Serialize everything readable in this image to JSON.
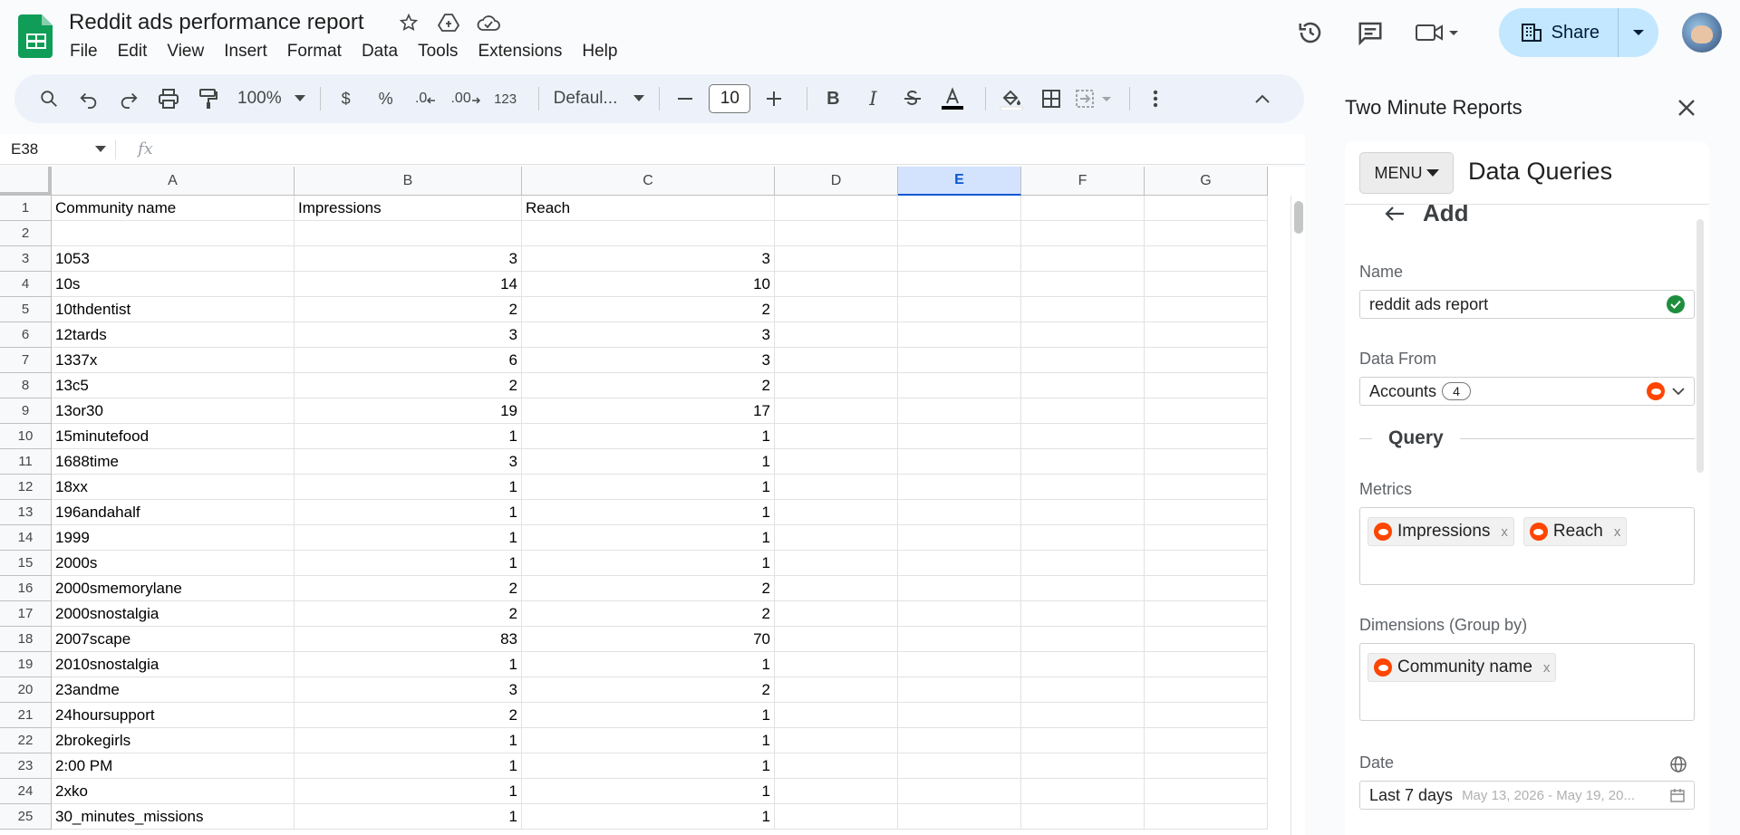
{
  "doc": {
    "title": "Reddit ads performance report",
    "menus": [
      "File",
      "Edit",
      "View",
      "Insert",
      "Format",
      "Data",
      "Tools",
      "Extensions",
      "Help"
    ],
    "share_label": "Share"
  },
  "toolbar": {
    "zoom": "100%",
    "currency": "$",
    "percent": "%",
    "dec_decrease": ".0",
    "dec_increase": ".00",
    "more_formats": "123",
    "font": "Defaul...",
    "font_size": "10",
    "bold": "B",
    "italic": "I"
  },
  "formula": {
    "cell_ref": "E38",
    "fx": "fx"
  },
  "sheet": {
    "columns": [
      "A",
      "B",
      "C",
      "D",
      "E",
      "F",
      "G"
    ],
    "selected_column": "E",
    "header_row": [
      "Community name",
      "Impressions",
      "Reach"
    ],
    "rows": [
      [
        "1053",
        "3",
        "3"
      ],
      [
        "10s",
        "14",
        "10"
      ],
      [
        "10thdentist",
        "2",
        "2"
      ],
      [
        "12tards",
        "3",
        "3"
      ],
      [
        "1337x",
        "6",
        "3"
      ],
      [
        "13c5",
        "2",
        "2"
      ],
      [
        "13or30",
        "19",
        "17"
      ],
      [
        "15minutefood",
        "1",
        "1"
      ],
      [
        "1688time",
        "3",
        "1"
      ],
      [
        "18xx",
        "1",
        "1"
      ],
      [
        "196andahalf",
        "1",
        "1"
      ],
      [
        "1999",
        "1",
        "1"
      ],
      [
        "2000s",
        "1",
        "1"
      ],
      [
        "2000smemorylane",
        "2",
        "2"
      ],
      [
        "2000snostalgia",
        "2",
        "2"
      ],
      [
        "2007scape",
        "83",
        "70"
      ],
      [
        "2010snostalgia",
        "1",
        "1"
      ],
      [
        "23andme",
        "3",
        "2"
      ],
      [
        "24hoursupport",
        "2",
        "1"
      ],
      [
        "2brokegirls",
        "1",
        "1"
      ],
      [
        "2:00 PM",
        "1",
        "1"
      ],
      [
        "2xko",
        "1",
        "1"
      ],
      [
        "30_minutes_missions",
        "1",
        "1"
      ]
    ]
  },
  "panel": {
    "title": "Two Minute Reports",
    "menu_label": "MENU",
    "card_title": "Data Queries",
    "add_label": "Add",
    "name_label": "Name",
    "name_value": "reddit ads report",
    "data_from_label": "Data From",
    "data_from_value": "Accounts",
    "accounts_count": "4",
    "query_label": "Query",
    "metrics_label": "Metrics",
    "metrics": [
      "Impressions",
      "Reach"
    ],
    "dimensions_label": "Dimensions (Group by)",
    "dimensions": [
      "Community name"
    ],
    "date_label": "Date",
    "date_value": "Last 7 days",
    "date_range": "May 13, 2026 - May 19, 20...",
    "remove_mark": "x"
  },
  "colors": {
    "sheets_green": "#0f9d58",
    "share_bg": "#c2e7ff",
    "selected_col": "#d3e3fd",
    "reddit_orange": "#ff4500"
  }
}
